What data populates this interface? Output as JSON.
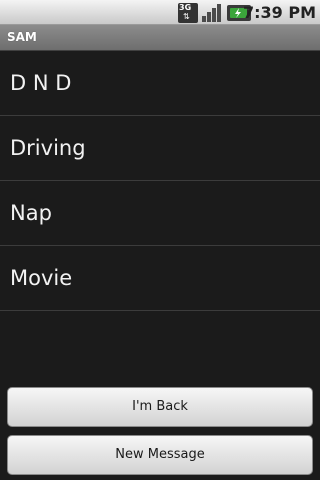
{
  "status_bar": {
    "network_type": "3G",
    "network_activity_glyph": "⇅",
    "time": "7:39 PM",
    "icons": [
      "3g-icon",
      "signal-icon",
      "battery-charging-icon"
    ]
  },
  "title_bar": {
    "title": "SAM"
  },
  "list": {
    "items": [
      {
        "label": "D N D"
      },
      {
        "label": "Driving"
      },
      {
        "label": "Nap"
      },
      {
        "label": "Movie"
      }
    ]
  },
  "buttons": {
    "back_label": "I'm Back",
    "new_message_label": "New Message"
  },
  "colors": {
    "background": "#1b1b1b",
    "divider": "#3c3c3c",
    "title_bar": "#7d7d7d",
    "button_face": "#e4e4e4",
    "battery_accent": "#3ba53b"
  }
}
